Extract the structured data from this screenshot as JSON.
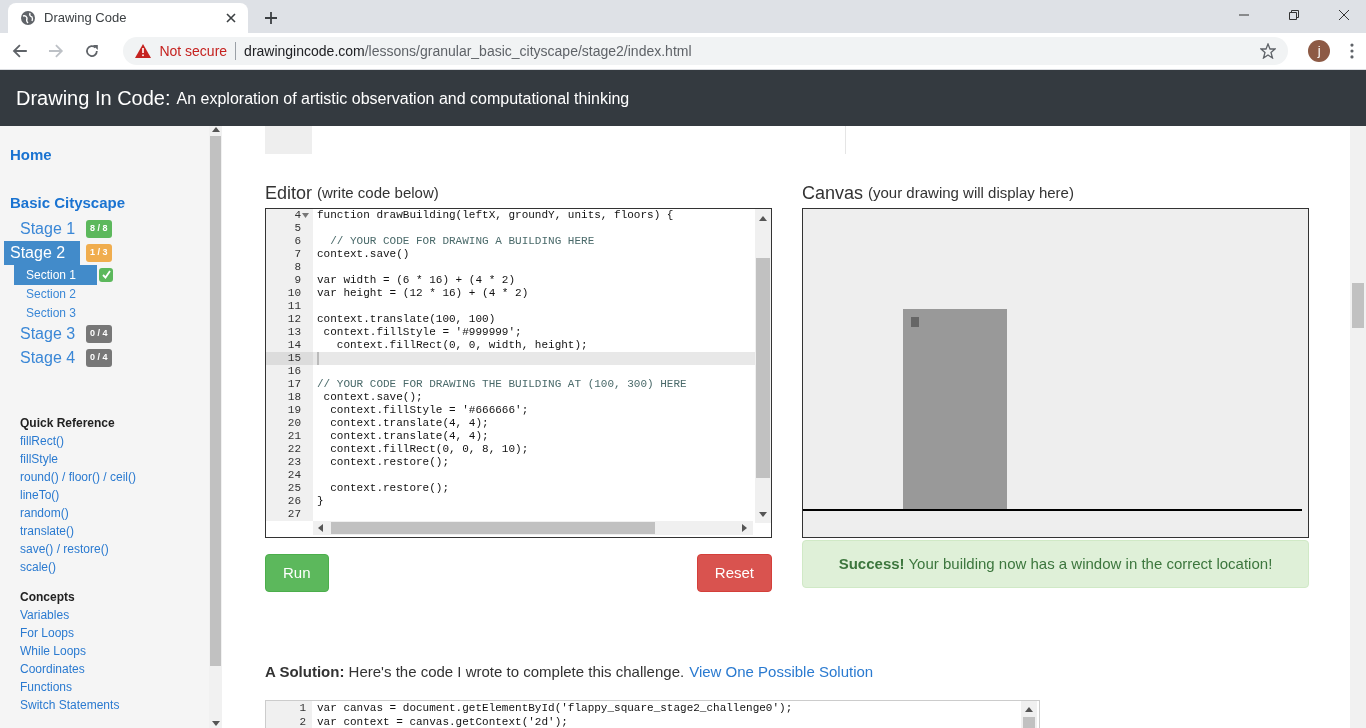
{
  "browser": {
    "tab_title": "Drawing Code",
    "security": "Not secure",
    "url_host": "drawingincode.com",
    "url_path": "/lessons/granular_basic_cityscape/stage2/index.html",
    "avatar": "j"
  },
  "header": {
    "title": "Drawing In Code:",
    "subtitle": "An exploration of artistic observation and computational thinking"
  },
  "sidebar": {
    "home": "Home",
    "course": "Basic Cityscape",
    "stages": [
      {
        "label": "Stage 1",
        "selected": false,
        "badge": "8 / 8",
        "color": "#5cb85c"
      },
      {
        "label": "Stage 2",
        "selected": true,
        "badge": "1 / 3",
        "color": "#f0ad4e",
        "sections": [
          {
            "label": "Section 1",
            "selected": true,
            "done": true
          },
          {
            "label": "Section 2",
            "selected": false,
            "done": false
          },
          {
            "label": "Section 3",
            "selected": false,
            "done": false
          }
        ]
      },
      {
        "label": "Stage 3",
        "selected": false,
        "badge": "0 / 4",
        "color": "#777777"
      },
      {
        "label": "Stage 4",
        "selected": false,
        "badge": "0 / 4",
        "color": "#777777"
      }
    ],
    "groups": [
      {
        "title": "Quick Reference",
        "links": [
          "fillRect()",
          "fillStyle",
          "round() / floor() / ceil()",
          "lineTo()",
          "random()",
          "translate()",
          "save() / restore()",
          "scale()"
        ]
      },
      {
        "title": "Concepts",
        "links": [
          "Variables",
          "For Loops",
          "While Loops",
          "Coordinates",
          "Functions",
          "Switch Statements"
        ]
      }
    ]
  },
  "editor": {
    "title": "Editor",
    "hint": "(write code below)",
    "lines": [
      {
        "number": "4",
        "text": "function drawBuilding(leftX, groundY, units, floors) {",
        "kind": "code",
        "active": false,
        "foldable": true
      },
      {
        "number": "5",
        "active": false
      },
      {
        "number": "6",
        "text": "  // YOUR CODE FOR DRAWING A BUILDING HERE",
        "kind": "comment",
        "active": false
      },
      {
        "number": "7",
        "text": "context.save()",
        "kind": "code",
        "active": false
      },
      {
        "number": "8",
        "active": false
      },
      {
        "number": "9",
        "text": "var width = (6 * 16) + (4 * 2)",
        "kind": "code",
        "active": false
      },
      {
        "number": "10",
        "text": "var height = (12 * 16) + (4 * 2)",
        "kind": "code",
        "active": false
      },
      {
        "number": "11",
        "active": false
      },
      {
        "number": "12",
        "text": "context.translate(100, 100)",
        "kind": "code",
        "active": false
      },
      {
        "number": "13",
        "text": " context.fillStyle = '#999999';",
        "kind": "code",
        "active": false
      },
      {
        "number": "14",
        "text": "   context.fillRect(0, 0, width, height);",
        "kind": "code",
        "active": false
      },
      {
        "number": "15",
        "active": true
      },
      {
        "number": "16",
        "active": false
      },
      {
        "number": "17",
        "text": "// YOUR CODE FOR DRAWING THE BUILDING AT (100, 300) HERE",
        "kind": "comment",
        "active": false
      },
      {
        "number": "18",
        "text": " context.save();",
        "kind": "code",
        "active": false
      },
      {
        "number": "19",
        "text": "  context.fillStyle = '#666666';",
        "kind": "code",
        "active": false
      },
      {
        "number": "20",
        "text": "  context.translate(4, 4);",
        "kind": "code",
        "active": false
      },
      {
        "number": "21",
        "text": "  context.translate(4, 4);",
        "kind": "code",
        "active": false
      },
      {
        "number": "22",
        "text": "  context.fillRect(0, 0, 8, 10);",
        "kind": "code",
        "active": false
      },
      {
        "number": "23",
        "text": "  context.restore();",
        "kind": "code",
        "active": false
      },
      {
        "number": "24",
        "active": false
      },
      {
        "number": "25",
        "text": "  context.restore();",
        "kind": "code",
        "active": false
      },
      {
        "number": "26",
        "text": "}",
        "kind": "code",
        "active": false
      },
      {
        "number": "27",
        "active": false
      }
    ],
    "buttons": [
      {
        "label": "Run",
        "kind": "run"
      },
      {
        "label": "Reset",
        "kind": "reset"
      }
    ]
  },
  "canvas": {
    "title": "Canvas",
    "hint": "(your drawing will display here)",
    "alert_bold": "Success!",
    "alert": "Your building now has a window in the correct location!"
  },
  "solution": {
    "label": "A Solution:",
    "text": "Here's the code I wrote to complete this challenge.",
    "link": "View One Possible Solution",
    "lines": [
      {
        "number": "1",
        "text": "var canvas = document.getElementById('flappy_square_stage2_challenge0');"
      },
      {
        "number": "2",
        "text": "var context = canvas.getContext('2d');"
      }
    ]
  }
}
